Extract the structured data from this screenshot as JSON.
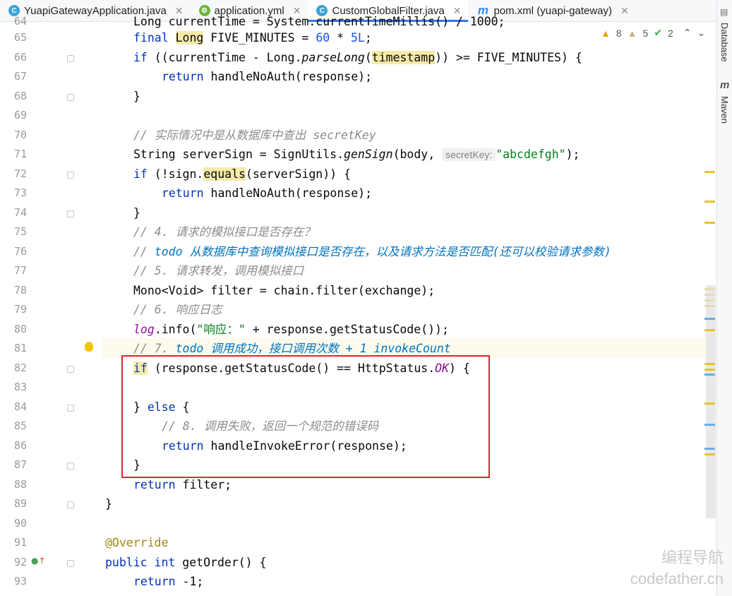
{
  "tabs": [
    {
      "label": "YuapiGatewayApplication.java",
      "icon": "c-icon",
      "active": false
    },
    {
      "label": "application.yml",
      "icon": "spring-icon",
      "active": false
    },
    {
      "label": "CustomGlobalFilter.java",
      "icon": "c-icon",
      "active": true
    },
    {
      "label": "pom.xml (yuapi-gateway)",
      "icon": "m-icon",
      "active": false
    }
  ],
  "right_stripe": {
    "database": "Database",
    "maven": "Maven"
  },
  "inspection": {
    "warnings": "8",
    "weak_warnings": "5",
    "typos": "2"
  },
  "line_numbers": [
    "64",
    "65",
    "66",
    "67",
    "68",
    "69",
    "70",
    "71",
    "72",
    "73",
    "74",
    "75",
    "76",
    "77",
    "78",
    "79",
    "80",
    "81",
    "82",
    "83",
    "84",
    "85",
    "86",
    "87",
    "88",
    "89",
    "90",
    "91",
    "92",
    "93"
  ],
  "code": {
    "l64": "Long currentTime = System.currentTimeMillis() / 1000;",
    "l65_a": "final ",
    "l65_b": "Long",
    "l65_c": " FIVE_MINUTES = ",
    "l65_d": "60",
    "l65_e": " * ",
    "l65_f": "5L",
    "l65_g": ";",
    "l66_a": "if",
    "l66_b": " ((currentTime - Long.",
    "l66_c": "parseLong",
    "l66_d": "(",
    "l66_e": "timestamp",
    "l66_f": ")) >= FIVE_MINUTES) {",
    "l67_a": "return",
    "l67_b": " handleNoAuth(response);",
    "l68": "}",
    "l70": "// 实际情况中是从数据库中查出 secretKey",
    "l71_a": "String serverSign = SignUtils.",
    "l71_b": "genSign",
    "l71_c": "(body, ",
    "l71_hint": "secretKey:",
    "l71_d": "\"abcdefgh\"",
    "l71_e": ");",
    "l72_a": "if",
    "l72_b": " (!sign.",
    "l72_c": "equals",
    "l72_d": "(serverSign)) {",
    "l73_a": "return",
    "l73_b": " handleNoAuth(response);",
    "l74": "}",
    "l75": "// 4. 请求的模拟接口是否存在？",
    "l76_a": "// ",
    "l76_b": "todo 从数据库中查询模拟接口是否存在，以及请求方法是否匹配(还可以校验请求参数)",
    "l77": "// 5. 请求转发，调用模拟接口",
    "l78": "Mono<Void> filter = chain.filter(exchange);",
    "l79": "// 6. 响应日志",
    "l80_a": "log",
    "l80_b": ".info(",
    "l80_c": "\"响应：\"",
    "l80_d": " + response.getStatusCode());",
    "l81_a": "// 7. ",
    "l81_b": "todo 调用成功，接口调用次数 + 1 invokeCount",
    "l82_a": "if",
    "l82_b": " (response.getStatusCode() == HttpStatus.",
    "l82_c": "OK",
    "l82_d": ") {",
    "l84_a": "} ",
    "l84_b": "else",
    "l84_c": " {",
    "l85": "// 8. 调用失败，返回一个规范的错误码",
    "l86_a": "return",
    "l86_b": " handleInvokeError(response);",
    "l87": "}",
    "l88_a": "return",
    "l88_b": " filter;",
    "l89": "}",
    "l91": "@Override",
    "l92_a": "public int",
    "l92_b": " getOrder() {",
    "l93_a": "return",
    "l93_b": " -1;"
  },
  "watermark": {
    "line1": "编程导航",
    "line2": "codefather.cn"
  }
}
